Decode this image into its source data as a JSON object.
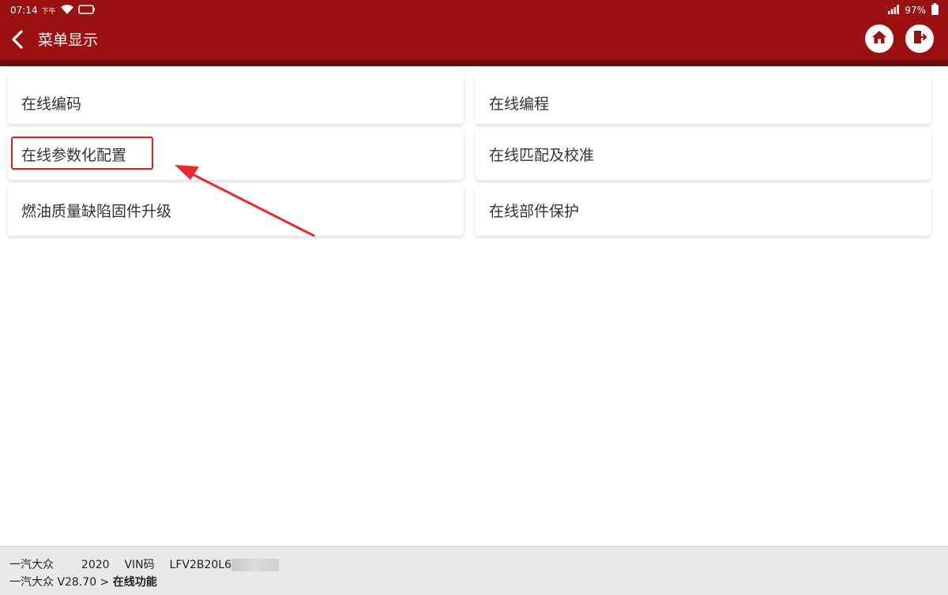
{
  "status_bar": {
    "time": "07:14",
    "ampm": "下午",
    "battery": "97%"
  },
  "header": {
    "title": "菜单显示"
  },
  "menu": {
    "items": [
      {
        "label": "在线编码"
      },
      {
        "label": "在线编程"
      },
      {
        "label": "在线参数化配置"
      },
      {
        "label": "在线匹配及校准"
      },
      {
        "label": "燃油质量缺陷固件升级"
      },
      {
        "label": "在线部件保护"
      }
    ],
    "highlighted_index": 2
  },
  "footer": {
    "brand": "一汽大众",
    "year": "2020",
    "vin_label": "VIN码",
    "vin_visible": "LFV2B20L6",
    "path_prefix": "一汽大众 V28.70 >",
    "path_current": "在线功能"
  },
  "colors": {
    "header": "#9b1010",
    "highlight": "#e02020",
    "footer": "#e9e9e9"
  },
  "icons": [
    "wifi-icon",
    "battery-icon",
    "signal-icon",
    "back-icon",
    "home-icon",
    "exit-icon"
  ]
}
